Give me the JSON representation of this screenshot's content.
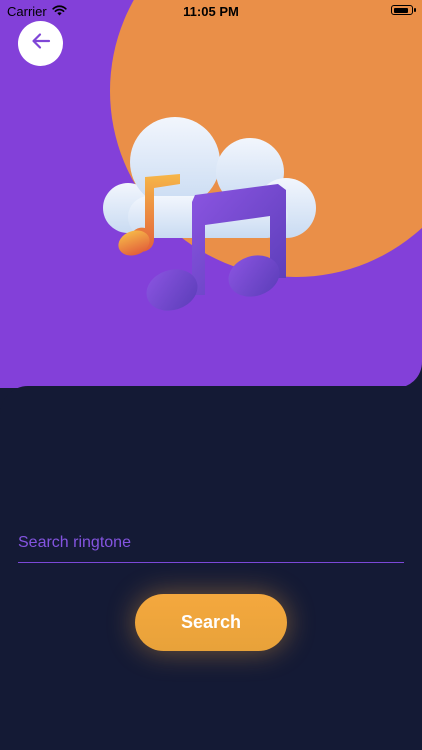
{
  "status_bar": {
    "carrier": "Carrier",
    "time": "11:05 PM",
    "battery_level": 0.9
  },
  "header": {
    "back_icon": "arrow-left-icon"
  },
  "illustration": {
    "icon": "cloud-music-note-icon"
  },
  "search": {
    "placeholder": "Search ringtone",
    "value": "",
    "button_label": "Search"
  },
  "colors": {
    "hero_background": "#8340d9",
    "accent_orange": "#ea8f48",
    "dark_background": "#141a35",
    "button": "#f0a43c",
    "placeholder": "#8454e0"
  }
}
